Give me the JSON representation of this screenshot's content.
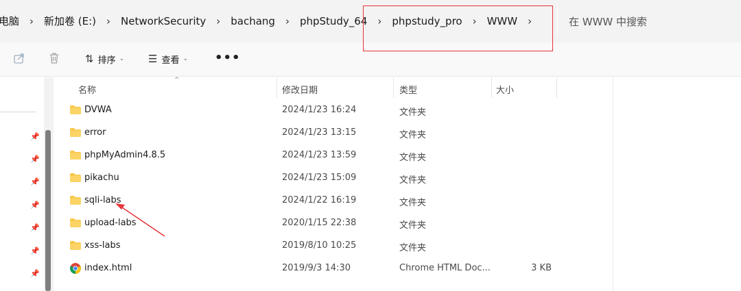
{
  "address_bar": {
    "crumbs": [
      "电脑",
      "新加卷 (E:)",
      "NetworkSecurity",
      "bachang",
      "phpStudy_64",
      "phpstudy_pro",
      "WWW"
    ],
    "search_placeholder": "在 WWW 中搜索"
  },
  "toolbar": {
    "share_icon": "share-icon",
    "delete_icon": "trash-icon",
    "sort_label": "排序",
    "view_label": "查看",
    "more_label": "•••"
  },
  "columns": {
    "name": "名称",
    "modified": "修改日期",
    "type": "类型",
    "size": "大小"
  },
  "files": [
    {
      "name": "DVWA",
      "modified": "2024/1/23 16:24",
      "type": "文件夹",
      "size": "",
      "icon": "folder-icon"
    },
    {
      "name": "error",
      "modified": "2024/1/23 13:15",
      "type": "文件夹",
      "size": "",
      "icon": "folder-icon"
    },
    {
      "name": "phpMyAdmin4.8.5",
      "modified": "2024/1/23 13:59",
      "type": "文件夹",
      "size": "",
      "icon": "folder-icon"
    },
    {
      "name": "pikachu",
      "modified": "2024/1/23 15:09",
      "type": "文件夹",
      "size": "",
      "icon": "folder-icon"
    },
    {
      "name": "sqli-labs",
      "modified": "2024/1/22 16:19",
      "type": "文件夹",
      "size": "",
      "icon": "folder-icon"
    },
    {
      "name": "upload-labs",
      "modified": "2020/1/15 22:38",
      "type": "文件夹",
      "size": "",
      "icon": "folder-icon"
    },
    {
      "name": "xss-labs",
      "modified": "2019/8/10 10:25",
      "type": "文件夹",
      "size": "",
      "icon": "folder-icon"
    },
    {
      "name": "index.html",
      "modified": "2019/9/3 14:30",
      "type": "Chrome HTML Doc...",
      "size": "3 KB",
      "icon": "chrome-icon"
    }
  ],
  "colors": {
    "highlight": "#e5343a",
    "folder": "#f8c74a",
    "folder_dark": "#e9b32f"
  }
}
